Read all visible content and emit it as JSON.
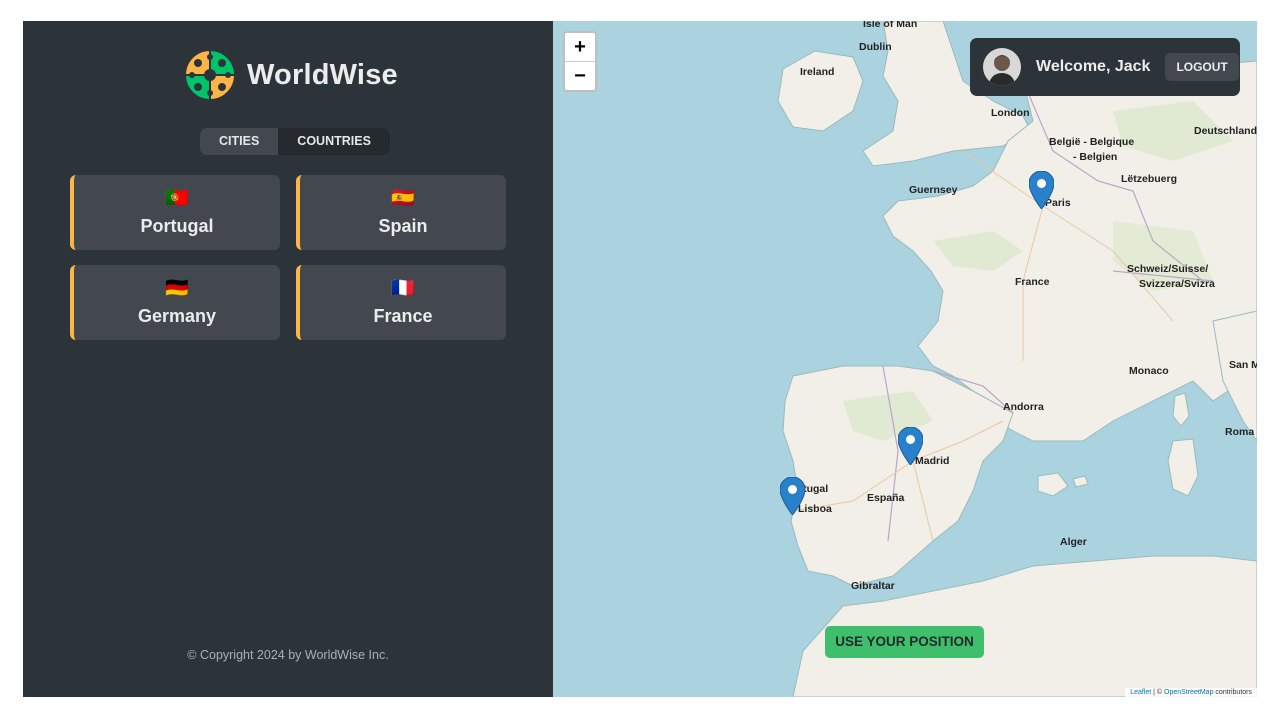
{
  "sidebar": {
    "app_name": "WorldWise",
    "tabs": [
      {
        "label": "CITIES",
        "active": false
      },
      {
        "label": "COUNTRIES",
        "active": true
      }
    ],
    "countries": [
      {
        "flag": "🇵🇹",
        "name": "Portugal"
      },
      {
        "flag": "🇪🇸",
        "name": "Spain"
      },
      {
        "flag": "🇩🇪",
        "name": "Germany"
      },
      {
        "flag": "🇫🇷",
        "name": "France"
      }
    ],
    "copyright": "© Copyright 2024 by WorldWise Inc."
  },
  "map": {
    "zoom_in": "+",
    "zoom_out": "−",
    "user": {
      "welcome": "Welcome, Jack",
      "logout_label": "LOGOUT"
    },
    "use_position_label": "USE YOUR POSITION",
    "attribution": {
      "leaflet": "Leaflet",
      "separator": "| ©",
      "osm": "OpenStreetMap",
      "suffix": "contributors"
    },
    "labels": {
      "isle_of_man": "Isle of Man",
      "dublin": "Dublin",
      "ireland": "Ireland",
      "london": "London",
      "belgie": "België - Belgique",
      "belgien": "- Belgien",
      "deutschland": "Deutschland",
      "letzebuerg": "Lëtzebuerg",
      "guernsey": "Guernsey",
      "paris": "Paris",
      "france": "France",
      "schweiz": "Schweiz/Suisse/",
      "svizzera": "Svizzera/Svizra",
      "monaco": "Monaco",
      "andorra": "Andorra",
      "madrid": "Madrid",
      "portugal": "rtugal",
      "lisboa": "Lisboa",
      "espana": "España",
      "gibraltar": "Gibraltar",
      "alger": "Alger",
      "roma": "Roma",
      "san_m": "San M"
    },
    "accent_colors": {
      "card_border": "#ffb545",
      "button": "#3fbf6b",
      "marker": "#2a81cb"
    }
  }
}
